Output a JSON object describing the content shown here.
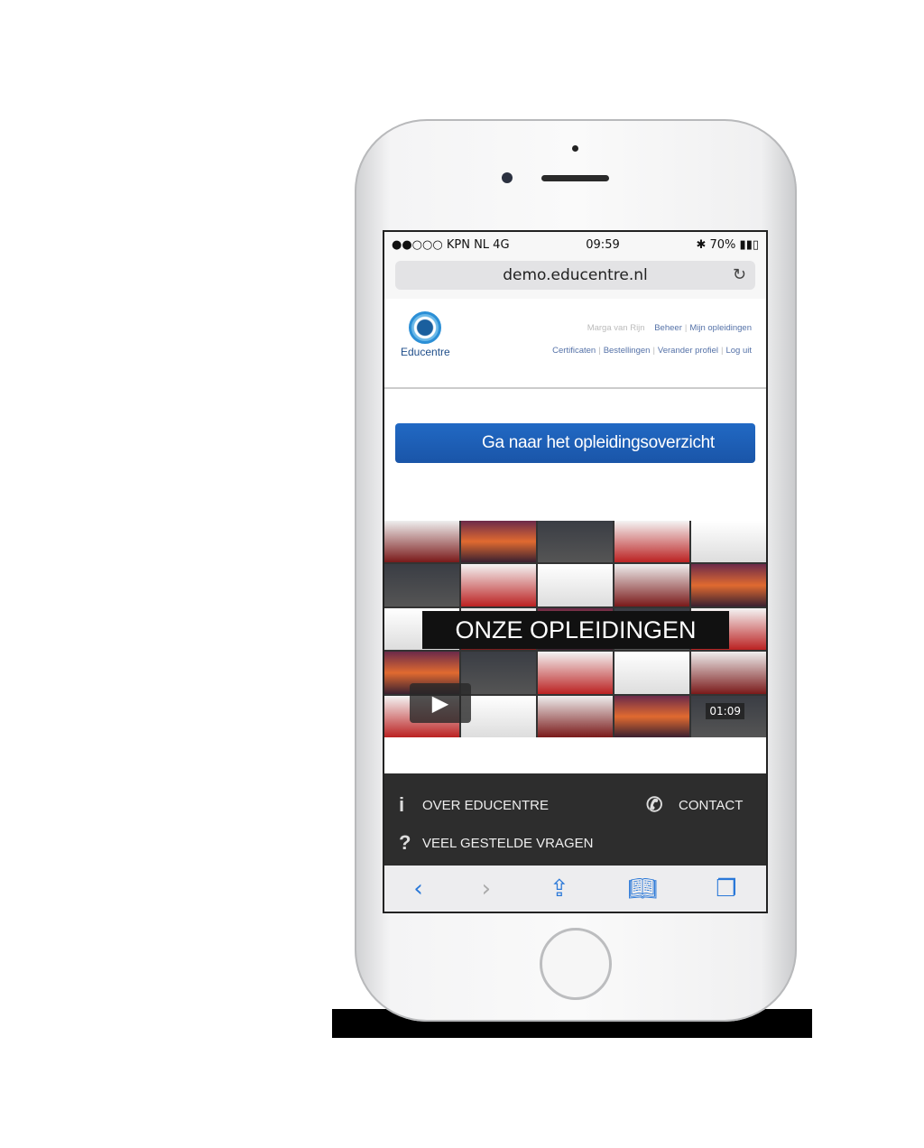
{
  "status": {
    "carrier": "●●○○○ KPN NL  4G",
    "time": "09:59",
    "battery": "✱ 70% ▮▮▯"
  },
  "browser": {
    "url": "demo.educentre.nl"
  },
  "header": {
    "logo_text": "Educentre",
    "user": "Marga van Rijn",
    "links_row1": [
      "Beheer",
      "Mijn opleidingen"
    ],
    "links_row2": [
      "Certificaten",
      "Bestellingen",
      "Verander profiel",
      "Log uit"
    ]
  },
  "cta": {
    "label": "Ga naar het opleidingsoverzicht"
  },
  "video": {
    "title": "ONZE OPLEIDINGEN",
    "duration": "01:09"
  },
  "footer": {
    "about": "OVER EDUCENTRE",
    "contact": "CONTACT",
    "faq": "VEEL GESTELDE VRAGEN"
  },
  "colors": {
    "accent": "#1f5fb8",
    "footer_bg": "#2d2d2d",
    "toolbar_icon": "#2a78d8"
  }
}
